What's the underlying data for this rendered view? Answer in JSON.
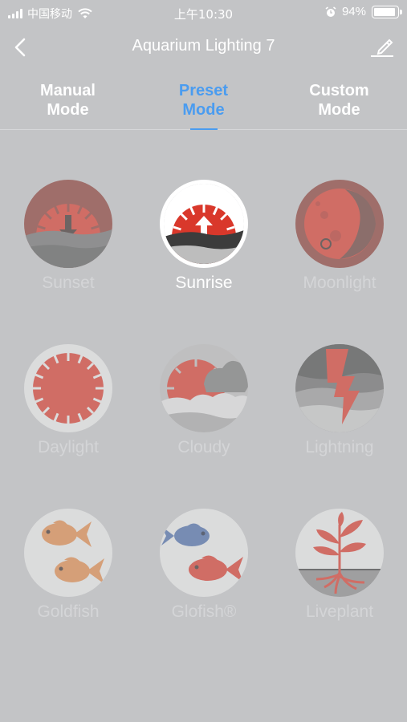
{
  "status_bar": {
    "carrier": "中国移动",
    "time": "上午10:30",
    "battery": "94%",
    "battery_level": 0.94
  },
  "nav": {
    "title": "Aquarium Lighting 7"
  },
  "tabs": [
    {
      "line1": "Manual",
      "line2": "Mode",
      "active": false
    },
    {
      "line1": "Preset",
      "line2": "Mode",
      "active": true
    },
    {
      "line1": "Custom",
      "line2": "Mode",
      "active": false
    }
  ],
  "presets": [
    {
      "label": "Sunset",
      "icon": "sunset-icon",
      "selected": false
    },
    {
      "label": "Sunrise",
      "icon": "sunrise-icon",
      "selected": true
    },
    {
      "label": "Moonlight",
      "icon": "moonlight-icon",
      "selected": false
    },
    {
      "label": "Daylight",
      "icon": "daylight-icon",
      "selected": false
    },
    {
      "label": "Cloudy",
      "icon": "cloudy-icon",
      "selected": false
    },
    {
      "label": "Lightning",
      "icon": "lightning-icon",
      "selected": false
    },
    {
      "label": "Goldfish",
      "icon": "goldfish-icon",
      "selected": false
    },
    {
      "label": "Glofish®",
      "icon": "glofish-icon",
      "selected": false
    },
    {
      "label": "Liveplant",
      "icon": "liveplant-icon",
      "selected": false
    }
  ],
  "colors": {
    "background": "#c3c4c6",
    "accent": "#4a9cf0",
    "red": "#d9382b",
    "orange": "#e08a4a",
    "blue": "#4a6ba8"
  }
}
